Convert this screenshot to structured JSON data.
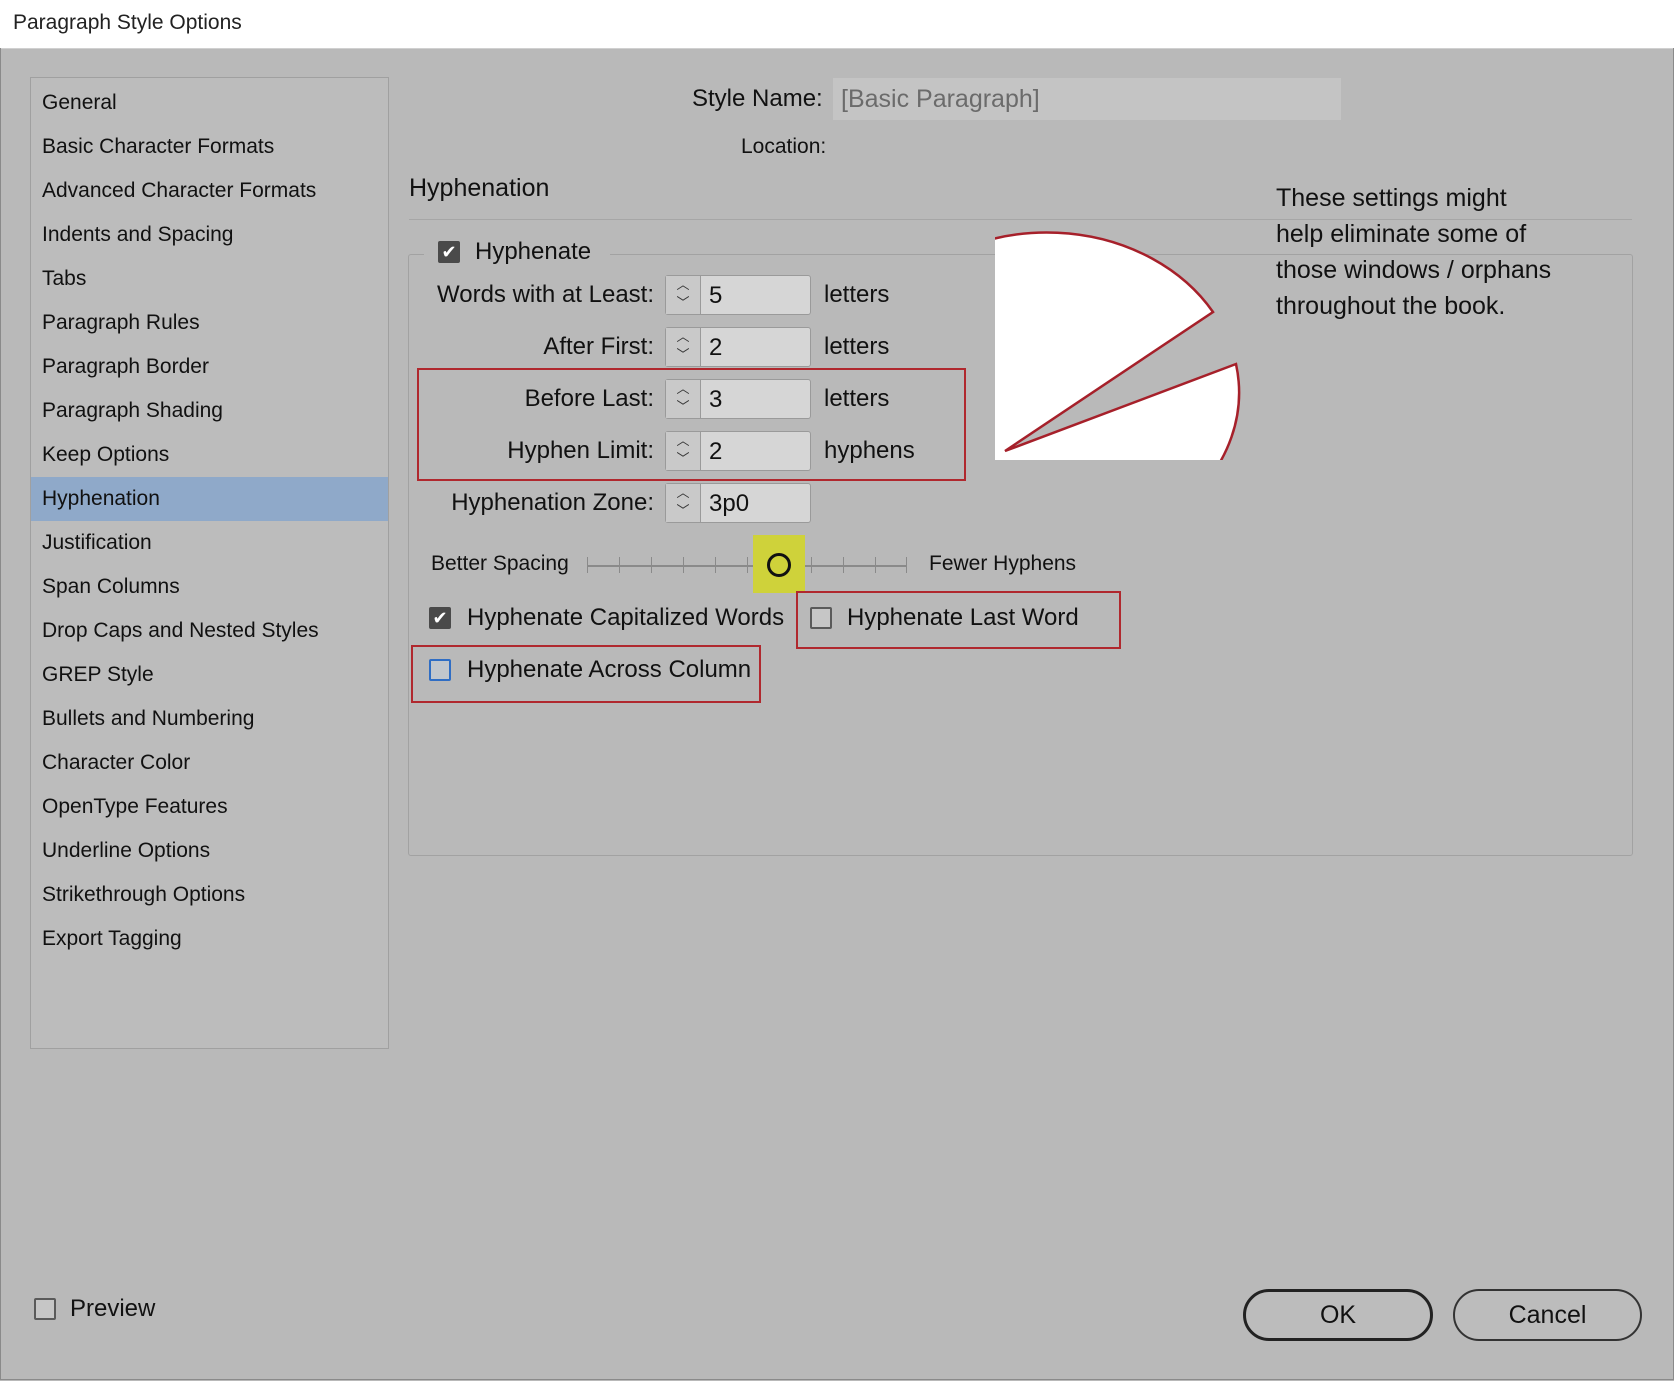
{
  "window": {
    "title": "Paragraph Style Options"
  },
  "sidebar": {
    "items": [
      "General",
      "Basic Character Formats",
      "Advanced Character Formats",
      "Indents and Spacing",
      "Tabs",
      "Paragraph Rules",
      "Paragraph Border",
      "Paragraph Shading",
      "Keep Options",
      "Hyphenation",
      "Justification",
      "Span Columns",
      "Drop Caps and Nested Styles",
      "GREP Style",
      "Bullets and Numbering",
      "Character Color",
      "OpenType Features",
      "Underline Options",
      "Strikethrough Options",
      "Export Tagging"
    ],
    "active": "Hyphenation"
  },
  "header": {
    "style_name_label": "Style Name:",
    "style_name_value": "[Basic Paragraph]",
    "location_label": "Location:"
  },
  "section": {
    "title": "Hyphenation"
  },
  "hyphenation": {
    "hyphenate_label": "Hyphenate",
    "hyphenate_checked": true,
    "words_with_at_least": {
      "label": "Words with at Least:",
      "value": "5",
      "unit": "letters"
    },
    "after_first": {
      "label": "After First:",
      "value": "2",
      "unit": "letters"
    },
    "before_last": {
      "label": "Before Last:",
      "value": "3",
      "unit": "letters"
    },
    "hyphen_limit": {
      "label": "Hyphen Limit:",
      "value": "2",
      "unit": "hyphens"
    },
    "hyphenation_zone": {
      "label": "Hyphenation Zone:",
      "value": "3p0"
    },
    "slider": {
      "left_label": "Better Spacing",
      "right_label": "Fewer Hyphens",
      "position": 6,
      "steps": 10
    },
    "capitalized_words": {
      "label": "Hyphenate Capitalized Words",
      "checked": true
    },
    "last_word": {
      "label": "Hyphenate Last Word",
      "checked": false
    },
    "across_column": {
      "label": "Hyphenate Across Column",
      "checked": false
    }
  },
  "callout": {
    "text": "These settings might help eliminate some of those windows / orphans throughout the book."
  },
  "footer": {
    "preview_label": "Preview",
    "preview_checked": false,
    "ok_label": "OK",
    "cancel_label": "Cancel"
  },
  "colors": {
    "highlight_box": "#b0282e",
    "slider_highlight": "#cfd23a",
    "active_item": "#8fa9c9"
  }
}
